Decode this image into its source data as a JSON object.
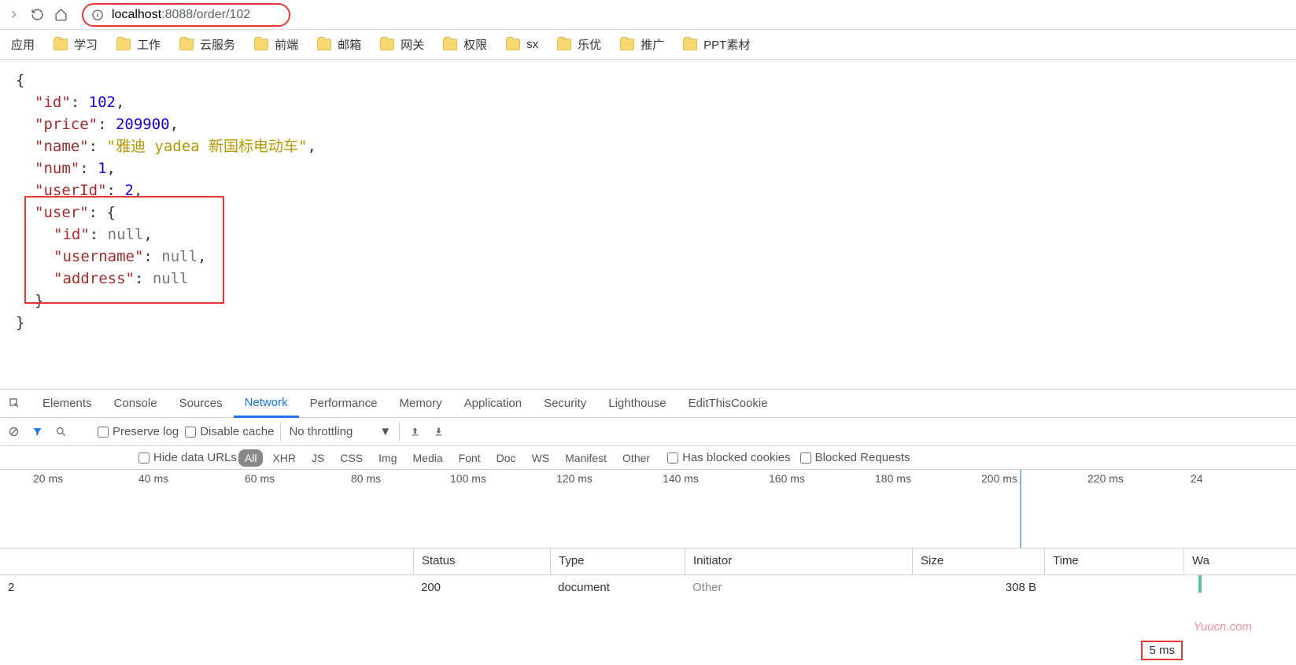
{
  "browser": {
    "url_host": "localhost",
    "url_path": ":8088/order/102"
  },
  "bookmarks": [
    "应用",
    "学习",
    "工作",
    "云服务",
    "前端",
    "邮箱",
    "网关",
    "权限",
    "sx",
    "乐优",
    "推广",
    "PPT素材"
  ],
  "json_response": {
    "id": {
      "key": "\"id\"",
      "val": "102"
    },
    "price": {
      "key": "\"price\"",
      "val": "209900"
    },
    "name": {
      "key": "\"name\"",
      "val": "\"雅迪 yadea 新国标电动车\""
    },
    "num": {
      "key": "\"num\"",
      "val": "1"
    },
    "userId": {
      "key": "\"userId\"",
      "val": "2"
    },
    "user": {
      "key": "\"user\"",
      "id": {
        "key": "\"id\"",
        "val": "null"
      },
      "username": {
        "key": "\"username\"",
        "val": "null"
      },
      "address": {
        "key": "\"address\"",
        "val": "null"
      }
    }
  },
  "devtools": {
    "tabs": [
      "Elements",
      "Console",
      "Sources",
      "Network",
      "Performance",
      "Memory",
      "Application",
      "Security",
      "Lighthouse",
      "EditThisCookie"
    ],
    "toolbar": {
      "preserve": "Preserve log",
      "disable": "Disable cache",
      "throttle": "No throttling"
    },
    "filters": {
      "hide": "Hide data URLs",
      "types": [
        "All",
        "XHR",
        "JS",
        "CSS",
        "Img",
        "Media",
        "Font",
        "Doc",
        "WS",
        "Manifest",
        "Other"
      ],
      "blocked_cookies": "Has blocked cookies",
      "blocked_req": "Blocked Requests"
    },
    "timeline_ticks": [
      "20 ms",
      "40 ms",
      "60 ms",
      "80 ms",
      "100 ms",
      "120 ms",
      "140 ms",
      "160 ms",
      "180 ms",
      "200 ms",
      "220 ms",
      "24"
    ],
    "net_headers": {
      "status": "Status",
      "type": "Type",
      "init": "Initiator",
      "size": "Size",
      "time": "Time",
      "wf": "Wa"
    },
    "net_row": {
      "name": "2",
      "status": "200",
      "type": "document",
      "init": "Other",
      "size": "308 B",
      "time": "5 ms"
    }
  },
  "watermark": "Yuucn.com"
}
